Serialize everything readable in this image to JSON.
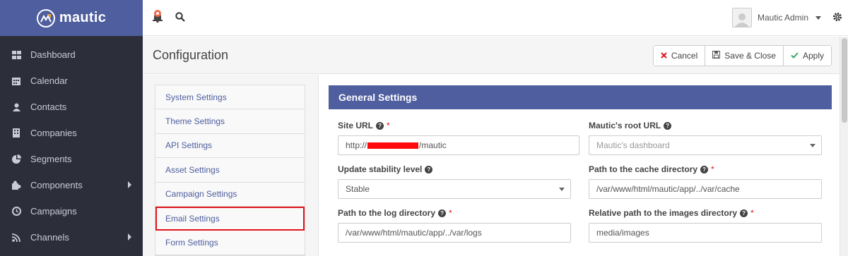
{
  "brand": {
    "name": "mautic"
  },
  "sidebar": {
    "items": [
      {
        "label": "Dashboard",
        "icon": "dashboard-icon"
      },
      {
        "label": "Calendar",
        "icon": "calendar-icon"
      },
      {
        "label": "Contacts",
        "icon": "user-icon"
      },
      {
        "label": "Companies",
        "icon": "building-icon"
      },
      {
        "label": "Segments",
        "icon": "pie-chart-icon"
      },
      {
        "label": "Components",
        "icon": "puzzle-icon",
        "has_submenu": true
      },
      {
        "label": "Campaigns",
        "icon": "clock-icon"
      },
      {
        "label": "Channels",
        "icon": "rss-icon",
        "has_submenu": true
      }
    ]
  },
  "topbar": {
    "user_name": "Mautic Admin"
  },
  "page": {
    "title": "Configuration",
    "buttons": {
      "cancel": "Cancel",
      "save_close": "Save & Close",
      "apply": "Apply"
    }
  },
  "settings_nav": {
    "items": [
      "System Settings",
      "Theme Settings",
      "API Settings",
      "Asset Settings",
      "Campaign Settings",
      "Email Settings",
      "Form Settings"
    ],
    "highlighted": "Email Settings"
  },
  "general": {
    "heading": "General Settings",
    "site_url": {
      "label": "Site URL",
      "value_prefix": "http://",
      "value_suffix": "/mautic"
    },
    "root_url": {
      "label": "Mautic's root URL",
      "value": "Mautic's dashboard"
    },
    "stability": {
      "label": "Update stability level",
      "value": "Stable"
    },
    "cache_dir": {
      "label": "Path to the cache directory",
      "value": "/var/www/html/mautic/app/../var/cache"
    },
    "log_dir": {
      "label": "Path to the log directory",
      "value": "/var/www/html/mautic/app/../var/logs"
    },
    "images_dir": {
      "label": "Relative path to the images directory",
      "value": "media/images"
    }
  },
  "colors": {
    "brand": "#4e5e9e",
    "sidebar_bg": "#2c2f3a",
    "required": "#e0151b",
    "highlight_outline": "#e0151b",
    "apply_check": "#3aa76d",
    "cancel_x": "#e0151b"
  }
}
